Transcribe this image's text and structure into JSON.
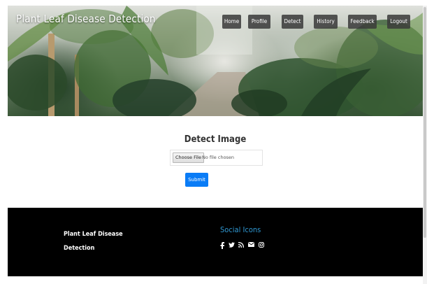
{
  "header": {
    "brand": "Plant Leaf Disease Detection"
  },
  "nav": {
    "items": [
      {
        "label": "Home"
      },
      {
        "label": "Profile"
      },
      {
        "label": "Detect"
      },
      {
        "label": "History"
      },
      {
        "label": "Feedback"
      },
      {
        "label": "Logout"
      }
    ]
  },
  "main": {
    "title": "Detect Image",
    "file_input": {
      "button_label": "Choose File",
      "status": "No file chosen"
    },
    "submit_label": "Submit"
  },
  "footer": {
    "brand_line1": "Plant Leaf Disease",
    "brand_line2": "Detection",
    "social_heading": "Social Icons",
    "social_icons": [
      "facebook-icon",
      "twitter-icon",
      "rss-icon",
      "envelope-icon",
      "instagram-icon"
    ]
  },
  "colors": {
    "nav_bg": "#3a3a3a",
    "submit_bg": "#0a7cf6",
    "footer_bg": "#000000",
    "social_heading": "#2f97d1"
  }
}
